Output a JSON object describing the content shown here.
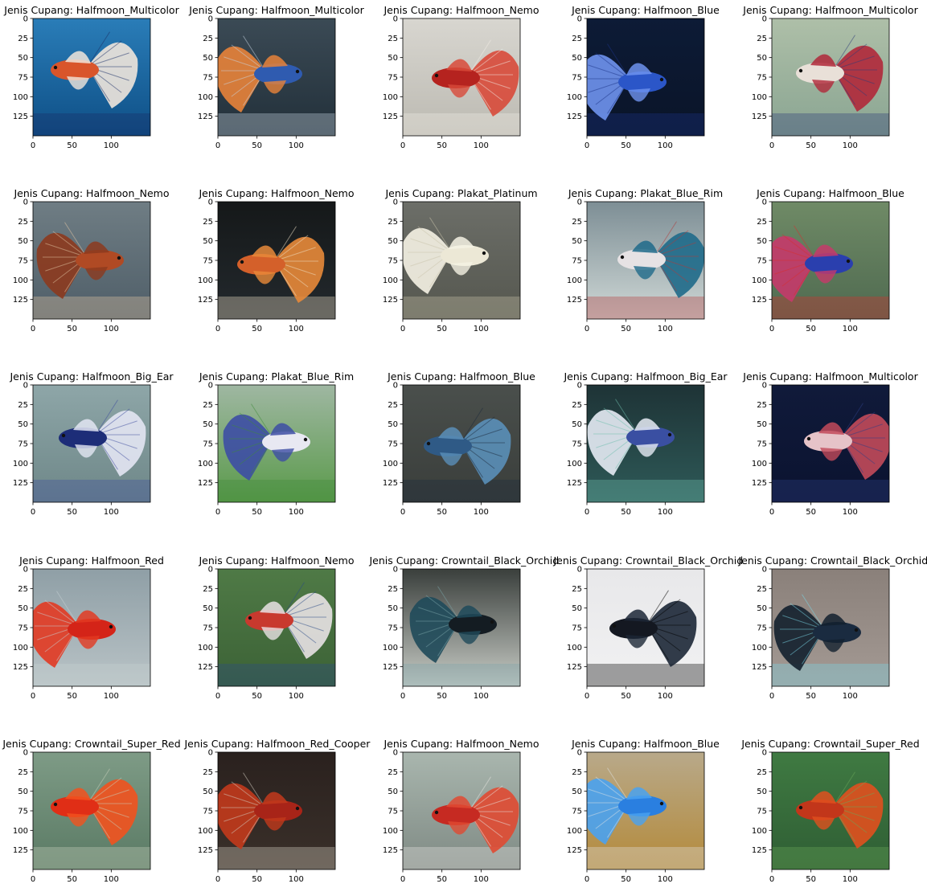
{
  "figure": {
    "title_prefix": "Jenis Cupang: ",
    "axis": {
      "x_ticks": [
        "0",
        "50",
        "100"
      ],
      "y_ticks": [
        "0",
        "25",
        "50",
        "75",
        "100",
        "125"
      ]
    },
    "panels": [
      {
        "label": "Jenis Cupang: Halfmoon_Multicolor",
        "bg": "#2a7db8",
        "fish": "#d9552b",
        "fin": "#f0e6dc",
        "accent": "#1b2f66",
        "water": "#0e4f86"
      },
      {
        "label": "Jenis Cupang: Halfmoon_Multicolor",
        "bg": "#3b4a55",
        "fish": "#2f5bb0",
        "fin": "#e8833a",
        "accent": "#c9d6e3",
        "water": "#22303a"
      },
      {
        "label": "Jenis Cupang: Halfmoon_Nemo",
        "bg": "#d8d6d0",
        "fish": "#b5231f",
        "fin": "#d84a3a",
        "accent": "#f2ede6",
        "water": "#bcbab2"
      },
      {
        "label": "Jenis Cupang: Halfmoon_Blue",
        "bg": "#0d1b36",
        "fish": "#2b56c8",
        "fin": "#6f93ef",
        "accent": "#1b3386",
        "water": "#0a1428"
      },
      {
        "label": "Jenis Cupang: Halfmoon_Multicolor",
        "bg": "#aebfa8",
        "fish": "#e9e0d8",
        "fin": "#b0283a",
        "accent": "#2d3b78",
        "water": "#8aa592"
      },
      {
        "label": "Jenis Cupang: Halfmoon_Nemo",
        "bg": "#6f7d84",
        "fish": "#b04a24",
        "fin": "#8c3a1e",
        "accent": "#e2c6a4",
        "water": "#4f5e68"
      },
      {
        "label": "Jenis Cupang: Halfmoon_Nemo",
        "bg": "#151819",
        "fish": "#d4602a",
        "fin": "#e88a3a",
        "accent": "#f1e3c8",
        "water": "#23292d"
      },
      {
        "label": "Jenis Cupang: Plakat_Platinum",
        "bg": "#6c6e68",
        "fish": "#ece8d6",
        "fin": "#f5f2e4",
        "accent": "#c9c3aa",
        "water": "#55574f"
      },
      {
        "label": "Jenis Cupang: Plakat_Blue_Rim",
        "bg": "#7d8e95",
        "fish": "#e6e2e4",
        "fin": "#1f6a8a",
        "accent": "#b23a3a",
        "water": "#cfd8d6"
      },
      {
        "label": "Jenis Cupang: Halfmoon_Blue",
        "bg": "#6f8a66",
        "fish": "#2a3fae",
        "fin": "#c53a6a",
        "accent": "#d82e2e",
        "water": "#4f6a50"
      },
      {
        "label": "Jenis Cupang: Halfmoon_Big_Ear",
        "bg": "#8ea6a8",
        "fish": "#1d2d78",
        "fin": "#e3e6f3",
        "accent": "#3d4c9e",
        "water": "#6e8788"
      },
      {
        "label": "Jenis Cupang: Plakat_Blue_Rim",
        "bg": "#9fb7a2",
        "fish": "#e8e8f2",
        "fin": "#3d4ea4",
        "accent": "#3f8a3a",
        "water": "#5a9a4a"
      },
      {
        "label": "Jenis Cupang: Halfmoon_Blue",
        "bg": "#4a4f4c",
        "fish": "#2f5a86",
        "fin": "#5a8fb8",
        "accent": "#1c2a3c",
        "water": "#3a3e3b"
      },
      {
        "label": "Jenis Cupang: Halfmoon_Big_Ear",
        "bg": "#1e3336",
        "fish": "#3a4fa2",
        "fin": "#e6ebf4",
        "accent": "#6fbfae",
        "water": "#2e5a58"
      },
      {
        "label": "Jenis Cupang: Halfmoon_Multicolor",
        "bg": "#101a3a",
        "fish": "#e6c3c8",
        "fin": "#c24a5a",
        "accent": "#2e3f86",
        "water": "#0b1330"
      },
      {
        "label": "Jenis Cupang: Halfmoon_Red",
        "bg": "#8f9fa6",
        "fish": "#d42418",
        "fin": "#e23a22",
        "accent": "#c7d0d2",
        "water": "#b9c3c6"
      },
      {
        "label": "Jenis Cupang: Halfmoon_Nemo",
        "bg": "#4f7a46",
        "fish": "#c8392e",
        "fin": "#e8e2e4",
        "accent": "#2a4a86",
        "water": "#3c6236"
      },
      {
        "label": "Jenis Cupang: Crowntail_Black_Orchid",
        "bg": "#3a3f3c",
        "fish": "#141c22",
        "fin": "#1f4a5a",
        "accent": "#7aa4a8",
        "water": "#c8ccc6"
      },
      {
        "label": "Jenis Cupang: Crowntail_Black_Orchid",
        "bg": "#e8e8ea",
        "fish": "#141821",
        "fin": "#1c2736",
        "accent": "#000000",
        "water": "#f1f1f2"
      },
      {
        "label": "Jenis Cupang: Crowntail_Black_Orchid",
        "bg": "#8a807a",
        "fish": "#1a2b40",
        "fin": "#13202e",
        "accent": "#7ad8e8",
        "water": "#a49a94"
      },
      {
        "label": "Jenis Cupang: Crowntail_Super_Red",
        "bg": "#7e9b86",
        "fish": "#e02e16",
        "fin": "#f2521e",
        "accent": "#c8d2bc",
        "water": "#5a7a64"
      },
      {
        "label": "Jenis Cupang: Halfmoon_Red_Cooper",
        "bg": "#2a211e",
        "fish": "#a82418",
        "fin": "#c23a1c",
        "accent": "#d6d0c4",
        "water": "#3a302a"
      },
      {
        "label": "Jenis Cupang: Halfmoon_Nemo",
        "bg": "#a9b6ae",
        "fish": "#c62a22",
        "fin": "#e04a32",
        "accent": "#e8e6e2",
        "water": "#7f8a84"
      },
      {
        "label": "Jenis Cupang: Halfmoon_Blue",
        "bg": "#b8a98a",
        "fish": "#2a7fe0",
        "fin": "#4aa2f0",
        "accent": "#dfe2e4",
        "water": "#b48a3a"
      },
      {
        "label": "Jenis Cupang: Crowntail_Super_Red",
        "bg": "#3f7a42",
        "fish": "#c2361a",
        "fin": "#e0501e",
        "accent": "#6aa85a",
        "water": "#2f5e34"
      }
    ]
  }
}
